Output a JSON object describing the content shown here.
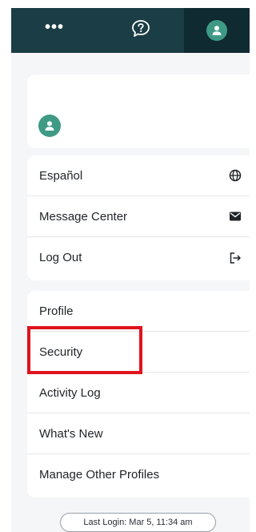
{
  "topbar": {
    "more_label": "•••",
    "help_icon": "help-chat-icon",
    "profile_icon": "user-icon"
  },
  "profile_card": {
    "avatar_icon": "user-icon"
  },
  "menu_group_1": {
    "items": [
      {
        "label": "Español",
        "icon": "globe-icon"
      },
      {
        "label": "Message Center",
        "icon": "envelope-icon"
      },
      {
        "label": "Log Out",
        "icon": "logout-icon"
      }
    ]
  },
  "menu_group_2": {
    "items": [
      {
        "label": "Profile"
      },
      {
        "label": "Security"
      },
      {
        "label": "Activity Log"
      },
      {
        "label": "What's New"
      },
      {
        "label": "Manage Other Profiles"
      }
    ]
  },
  "footer": {
    "last_login": "Last Login: Mar 5, 11:34 am"
  },
  "colors": {
    "topbar": "#1b3d45",
    "topbar_active": "#0f2a31",
    "avatar": "#3e9a85",
    "highlight": "#e0131d",
    "panel_bg": "#f5f6f7"
  }
}
